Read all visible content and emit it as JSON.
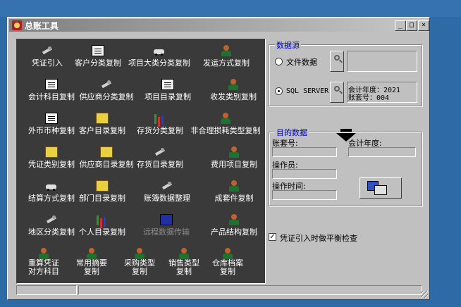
{
  "window": {
    "title": "总账工具",
    "controls": [
      "_",
      "□",
      "×"
    ]
  },
  "tools": [
    {
      "label": "凭证引入",
      "icon": "tool-icon"
    },
    {
      "label": "客户分类复制",
      "icon": "doc-icon"
    },
    {
      "label": "项目大类分类复制",
      "icon": "car-icon"
    },
    {
      "label": "发运方式复制",
      "icon": "person-icon"
    },
    {
      "label": "会计科目复制",
      "icon": "doc-icon"
    },
    {
      "label": "供应商分类复制",
      "icon": "tool-icon"
    },
    {
      "label": "项目目录复制",
      "icon": "doc-icon"
    },
    {
      "label": "收发类别复制",
      "icon": "person-icon"
    },
    {
      "label": "外币币种复制",
      "icon": "doc-icon"
    },
    {
      "label": "客户目录复制",
      "icon": "folder-icon"
    },
    {
      "label": "存货分类复制",
      "icon": "chart-icon"
    },
    {
      "label": "非合理损耗类型复制",
      "icon": "person-icon"
    },
    {
      "label": "凭证类别复制",
      "icon": "folder-icon"
    },
    {
      "label": "供应商目录复制",
      "icon": "folder-icon"
    },
    {
      "label": "存货目录复制",
      "icon": "tool-icon"
    },
    {
      "label": "费用项目复制",
      "icon": "person-icon"
    },
    {
      "label": "结算方式复制",
      "icon": "car-icon"
    },
    {
      "label": "部门目录复制",
      "icon": "folder-icon"
    },
    {
      "label": "账簿数据整理",
      "icon": "tool-icon"
    },
    {
      "label": "成套件复制",
      "icon": "person-icon"
    },
    {
      "label": "地区分类复制",
      "icon": "tool-icon"
    },
    {
      "label": "个人目录复制",
      "icon": "chart-icon"
    },
    {
      "label": "远程数据传输",
      "icon": "screen-icon",
      "disabled": true
    },
    {
      "label": "产品结构复制",
      "icon": "person-icon"
    }
  ],
  "tools_bottom": [
    {
      "line1": "重算凭证",
      "line2": "对方科目"
    },
    {
      "line1": "常用摘要",
      "line2": "复制"
    },
    {
      "line1": "采购类型",
      "line2": "复制"
    },
    {
      "line1": "销售类型",
      "line2": "复制"
    },
    {
      "line1": "仓库档案",
      "line2": "复制"
    }
  ],
  "datasource": {
    "title": "数据源",
    "option_file": "文件数据",
    "option_sql": "SQL SERVER",
    "selected": "SQL SERVER",
    "year_line": "会计年度：2021",
    "set_line": "账套号：004",
    "file_value": ""
  },
  "target": {
    "title": "目的数据",
    "account_set_label": "账套号:",
    "year_label": "会计年度:",
    "operator_label": "操作员:",
    "op_time_label": "操作时间:",
    "account_set_value": "",
    "year_value": "",
    "operator_value": "",
    "op_time_value": ""
  },
  "balance_check": {
    "label": "凭证引入时做平衡检查",
    "checked": true
  }
}
